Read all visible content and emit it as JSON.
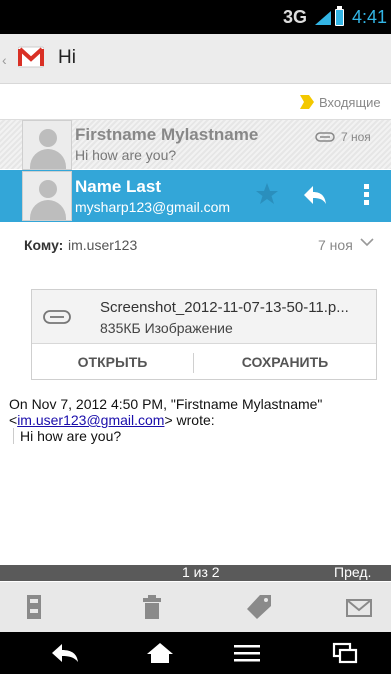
{
  "status_bar": {
    "network": "3G",
    "time": "4:41"
  },
  "action_bar": {
    "title": "Hi",
    "app_icon": "gmail-icon"
  },
  "folder": {
    "label": "Входящие",
    "label_color": "#f3c800"
  },
  "thread_item": {
    "sender": "Firstname Mylastname",
    "snippet": "Hi how are you?",
    "date": "7 ноя"
  },
  "message_header": {
    "name": "Name Last",
    "email": "mysharp123@gmail.com",
    "accent_color": "#33a6d8"
  },
  "recipient": {
    "label": "Кому:",
    "value": "im.user123",
    "date": "7 ноя"
  },
  "attachment": {
    "filename": "Screenshot_2012-11-07-13-50-11.p...",
    "info": "835КБ Изображение",
    "open_label": "ОТКРЫТЬ",
    "save_label": "СОХРАНИТЬ"
  },
  "body": {
    "quote_intro_before": "On Nov 7, 2012 4:50 PM, \"Firstname Mylastname\"",
    "quote_intro_lt": "<",
    "quote_email": "im.user123@gmail.com",
    "quote_intro_after": "> wrote:",
    "quoted_text": "Hi how are you?"
  },
  "pager": {
    "count": "1 из 2",
    "prev_label": "Пред."
  },
  "bottom_actions": [
    "archive-icon",
    "delete-icon",
    "label-icon",
    "mark-unread-icon"
  ],
  "nav_bar": [
    "back-icon",
    "home-icon",
    "menu-icon",
    "recent-apps-icon"
  ]
}
